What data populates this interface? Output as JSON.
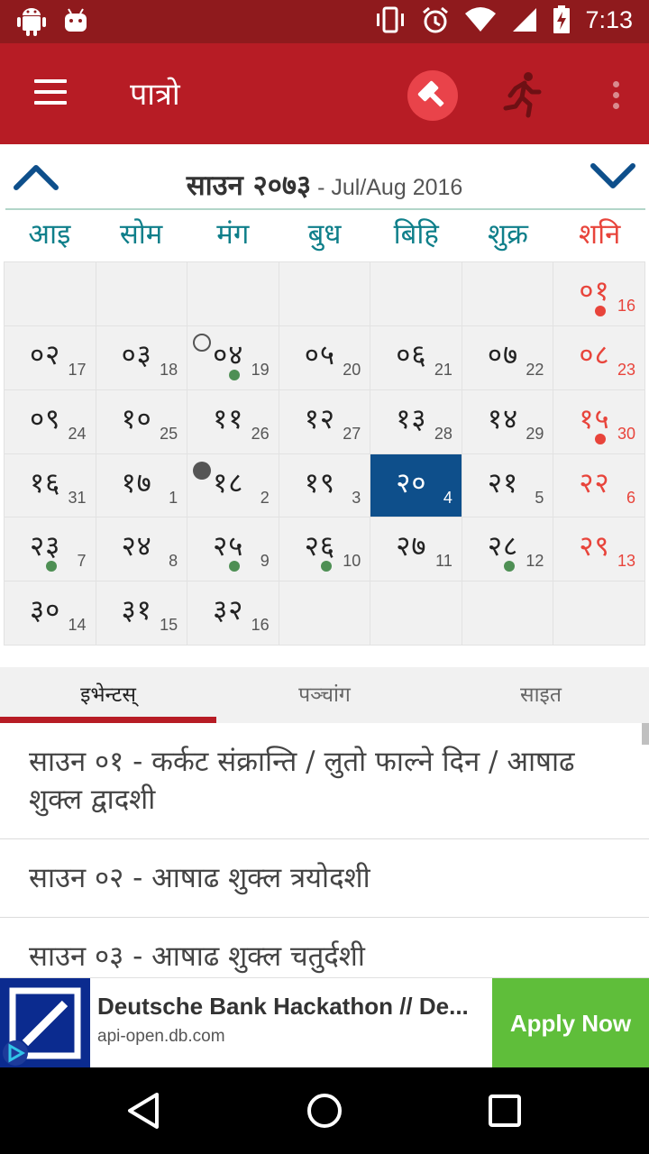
{
  "status_bar": {
    "time": "7:13",
    "icons": [
      "android-icon",
      "android-alt-icon",
      "vibrate-icon",
      "alarm-icon",
      "wifi-icon",
      "signal-icon",
      "battery-charging-icon"
    ]
  },
  "app_bar": {
    "title": "पात्रो",
    "icons": [
      "menu-icon",
      "hammer-icon",
      "running-man-icon",
      "more-vert-icon"
    ]
  },
  "month": {
    "nepali": "साउन २०७३",
    "english": " - Jul/Aug 2016"
  },
  "weekdays": [
    "आइ",
    "सोम",
    "मंग",
    "बुध",
    "बिहि",
    "शुक्र",
    "शनि"
  ],
  "calendar": {
    "cells": [
      {
        "np": "",
        "en": ""
      },
      {
        "np": "",
        "en": ""
      },
      {
        "np": "",
        "en": ""
      },
      {
        "np": "",
        "en": ""
      },
      {
        "np": "",
        "en": ""
      },
      {
        "np": "",
        "en": ""
      },
      {
        "np": "०१",
        "en": "16",
        "dot": true
      },
      {
        "np": "०२",
        "en": "17"
      },
      {
        "np": "०३",
        "en": "18"
      },
      {
        "np": "०४",
        "en": "19",
        "dot": true,
        "moon": "new"
      },
      {
        "np": "०५",
        "en": "20"
      },
      {
        "np": "०६",
        "en": "21"
      },
      {
        "np": "०७",
        "en": "22"
      },
      {
        "np": "०८",
        "en": "23"
      },
      {
        "np": "०९",
        "en": "24"
      },
      {
        "np": "१०",
        "en": "25"
      },
      {
        "np": "११",
        "en": "26"
      },
      {
        "np": "१२",
        "en": "27"
      },
      {
        "np": "१३",
        "en": "28"
      },
      {
        "np": "१४",
        "en": "29"
      },
      {
        "np": "१५",
        "en": "30",
        "dot": true
      },
      {
        "np": "१६",
        "en": "31"
      },
      {
        "np": "१७",
        "en": "1"
      },
      {
        "np": "१८",
        "en": "2",
        "moon": "full"
      },
      {
        "np": "१९",
        "en": "3"
      },
      {
        "np": "२०",
        "en": "4",
        "today": true
      },
      {
        "np": "२१",
        "en": "5"
      },
      {
        "np": "२२",
        "en": "6"
      },
      {
        "np": "२३",
        "en": "7",
        "dot": true
      },
      {
        "np": "२४",
        "en": "8"
      },
      {
        "np": "२५",
        "en": "9",
        "dot": true
      },
      {
        "np": "२६",
        "en": "10",
        "dot": true
      },
      {
        "np": "२७",
        "en": "11"
      },
      {
        "np": "२८",
        "en": "12",
        "dot": true
      },
      {
        "np": "२९",
        "en": "13"
      },
      {
        "np": "३०",
        "en": "14"
      },
      {
        "np": "३१",
        "en": "15"
      },
      {
        "np": "३२",
        "en": "16"
      },
      {
        "np": "",
        "en": ""
      },
      {
        "np": "",
        "en": ""
      },
      {
        "np": "",
        "en": ""
      },
      {
        "np": "",
        "en": ""
      }
    ]
  },
  "tabs": [
    {
      "label": "इभेन्टस्",
      "active": true
    },
    {
      "label": "पञ्चांग",
      "active": false
    },
    {
      "label": "साइत",
      "active": false
    }
  ],
  "events": [
    "साउन ०१ - कर्कट संक्रान्ति / लुतो फाल्ने दिन / आषाढ शुक्ल द्वादशी",
    "साउन ०२ - आषाढ शुक्ल त्रयोदशी",
    "साउन ०३ - आषाढ शुक्ल चतुर्दशी"
  ],
  "ad": {
    "title": "Deutsche Bank Hackathon // De...",
    "url": "api-open.db.com",
    "button": "Apply Now",
    "brand_color": "#0b2b8f",
    "button_color": "#5fbe3a"
  },
  "colors": {
    "primary": "#b71c25",
    "status_bar": "#8f1a1d",
    "weekday": "#0f7f8a",
    "saturday": "#e8443b",
    "today": "#0e4f8b",
    "event_dot": "#4e8f54"
  }
}
